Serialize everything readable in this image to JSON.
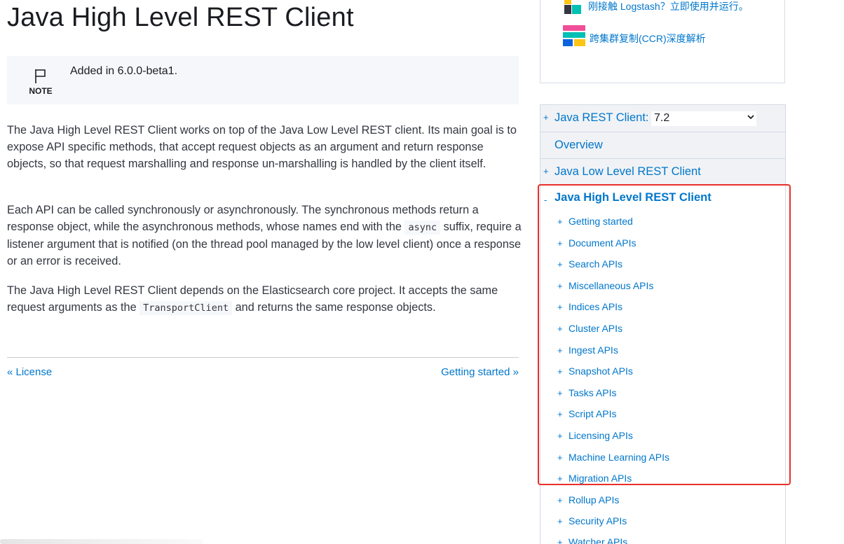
{
  "main": {
    "title": "Java High Level REST Client",
    "note": {
      "label": "NOTE",
      "text": "Added in 6.0.0-beta1."
    },
    "p1": "The Java High Level REST Client works on top of the Java Low Level REST client. Its main goal is to expose API specific methods, that accept request objects as an argument and return response objects, so that request marshalling and response un-marshalling is handled by the client itself.",
    "p2": {
      "before": "Each API can be called synchronously or asynchronously. The synchronous methods return a response object, while the asynchronous methods, whose names end with the ",
      "code": "async",
      "after": " suffix, require a listener argument that is notified (on the thread pool managed by the low level client) once a response or an error is received."
    },
    "p3": {
      "before": "The Java High Level REST Client depends on the Elasticsearch core project. It accepts the same request arguments as the ",
      "code": "TransportClient",
      "after": " and returns the same response objects."
    },
    "prev_link": "« License",
    "next_link": "Getting started »"
  },
  "promo": {
    "item1": "刚接触 Logstash？立即使用并运行。",
    "item2": "跨集群复制(CCR)深度解析"
  },
  "toc": {
    "version_label": "Java REST Client:",
    "version_value": "7.2",
    "overview": "Overview",
    "low_level": "Java Low Level REST Client",
    "current": "Java High Level REST Client",
    "items": [
      "Getting started",
      "Document APIs",
      "Search APIs",
      "Miscellaneous APIs",
      "Indices APIs",
      "Cluster APIs",
      "Ingest APIs",
      "Snapshot APIs",
      "Tasks APIs",
      "Script APIs",
      "Licensing APIs",
      "Machine Learning APIs",
      "Migration APIs",
      "Rollup APIs",
      "Security APIs",
      "Watcher APIs"
    ]
  },
  "colors": {
    "link": "#0077cc",
    "highlight": "#e8302a",
    "toc_bg": "#f0f2f5",
    "note_bg": "#f5f7fa"
  },
  "icons": {
    "note": "flag-icon",
    "promo1": "logstash-icon",
    "promo2": "ccr-icon"
  }
}
